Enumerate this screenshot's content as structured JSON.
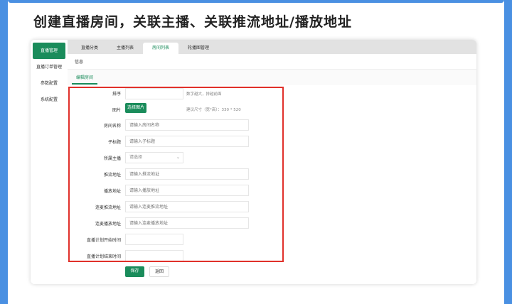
{
  "heading": "创建直播房间，关联主播、关联推流地址/播放地址",
  "sidebar": {
    "items": [
      "直播管理",
      "直播订单管理",
      "参数配置",
      "系统配置"
    ]
  },
  "tabs": [
    "直播分类",
    "主播列表",
    "房间列表",
    "轮播图管理"
  ],
  "active_tab": "房间列表",
  "info_title": "信息",
  "subtab": "编辑房间",
  "form": {
    "sort_label": "排序",
    "sort_hint": "数字越大，排越前面",
    "image_label": "图片",
    "image_button": "选择图片",
    "image_hint": "建议尺寸（宽*高）：330 * 520",
    "room_name_label": "房间名称",
    "room_name_placeholder": "请输入房间名称",
    "subtitle_label": "子标题",
    "subtitle_placeholder": "请输入子标题",
    "anchor_label": "所属主播",
    "anchor_value": "请选择",
    "push_url_label": "推流地址",
    "push_url_placeholder": "请输入推流地址",
    "play_url_label": "播放地址",
    "play_url_placeholder": "请输入播放地址",
    "link_push_label": "连麦推流地址",
    "link_push_placeholder": "请输入连麦推流地址",
    "link_play_label": "连麦播放地址",
    "link_play_placeholder": "请输入连麦播放地址",
    "start_time_label": "直播计划开始时间",
    "end_time_label": "直播计划结束时间",
    "save_button": "保存",
    "back_button": "返回"
  },
  "colors": {
    "primary": "#1a8c5b",
    "highlight": "#e0302a",
    "frame": "#4a90e2"
  }
}
